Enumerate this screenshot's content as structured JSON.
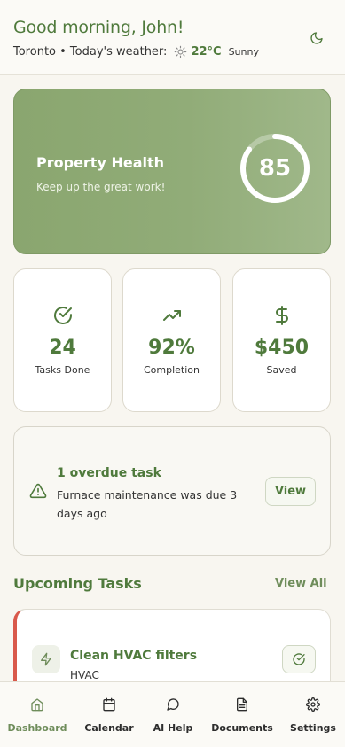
{
  "header": {
    "greeting": "Good morning, John!",
    "location_line": "Toronto • Today's weather:",
    "temperature": "22°C",
    "condition": "Sunny"
  },
  "health": {
    "title": "Property Health",
    "subtitle": "Keep up the great work!",
    "score": "85",
    "score_fraction": 0.85
  },
  "stats": [
    {
      "icon": "check-circle-icon",
      "value": "24",
      "label": "Tasks Done"
    },
    {
      "icon": "trending-up-icon",
      "value": "92%",
      "label": "Completion"
    },
    {
      "icon": "dollar-icon",
      "value": "$450",
      "label": "Saved"
    }
  ],
  "overdue": {
    "title": "1 overdue task",
    "description": "Furnace maintenance was due 3 days ago",
    "button_label": "View"
  },
  "upcoming": {
    "title": "Upcoming Tasks",
    "view_all_label": "View All",
    "tasks": [
      {
        "title": "Clean HVAC filters",
        "category": "HVAC",
        "priority_color": "#d9594b"
      }
    ]
  },
  "nav": [
    {
      "label": "Dashboard",
      "icon": "home-icon",
      "active": true
    },
    {
      "label": "Calendar",
      "icon": "calendar-icon",
      "active": false
    },
    {
      "label": "AI Help",
      "icon": "chat-icon",
      "active": false
    },
    {
      "label": "Documents",
      "icon": "document-icon",
      "active": false
    },
    {
      "label": "Settings",
      "icon": "gear-icon",
      "active": false
    }
  ],
  "colors": {
    "accent": "#4f7a3c",
    "card_green": "#8aa66f",
    "background": "#f8f6f0",
    "alert_red": "#d9594b"
  }
}
